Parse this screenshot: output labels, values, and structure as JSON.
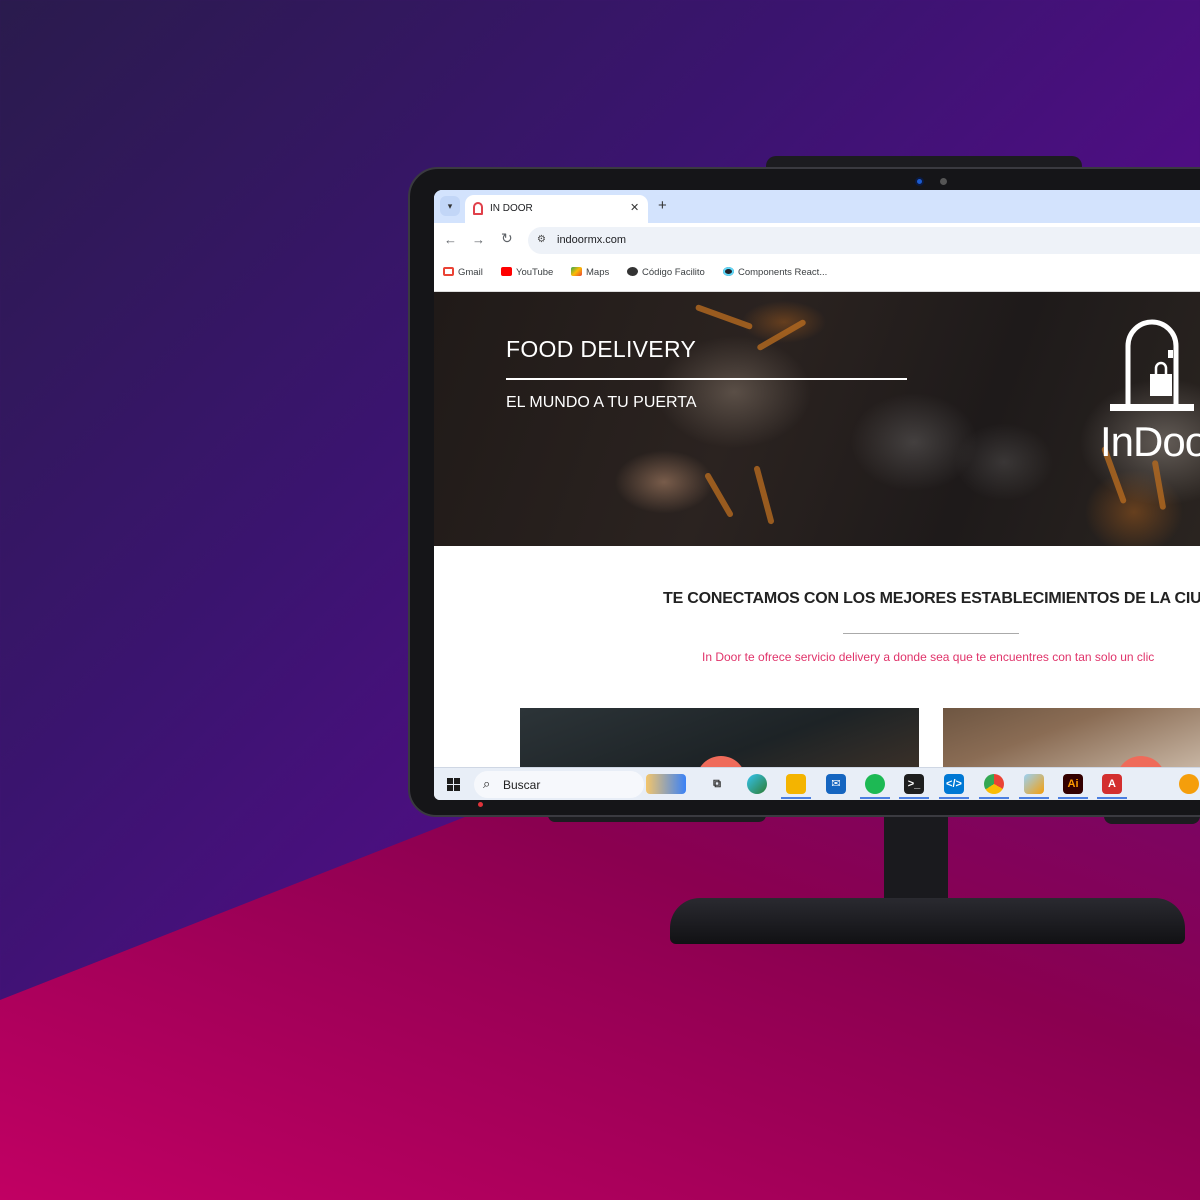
{
  "browser": {
    "tab_title": "IN DOOR",
    "url": "indoormx.com",
    "bookmarks": [
      "Gmail",
      "YouTube",
      "Maps",
      "Código Facilito",
      "Components React..."
    ]
  },
  "hero": {
    "title": "FOOD DELIVERY",
    "subtitle": "EL MUNDO A TU PUERTA",
    "logo_text": "InDoor"
  },
  "section": {
    "title": "TE CONECTAMOS CON LOS MEJORES ESTABLECIMIENTOS DE LA CIUDAD",
    "subtitle": "In Door te ofrece servicio delivery a donde sea que te encuentres con tan solo un clic"
  },
  "taskbar": {
    "search_label": "Buscar",
    "apps": [
      "task-view",
      "edge",
      "file-explorer",
      "mail",
      "spotify",
      "terminal",
      "vscode",
      "chrome",
      "paint",
      "illustrator",
      "acrobat"
    ]
  },
  "colors": {
    "accent": "#e0336a",
    "bubble": "#ef6b5a"
  }
}
